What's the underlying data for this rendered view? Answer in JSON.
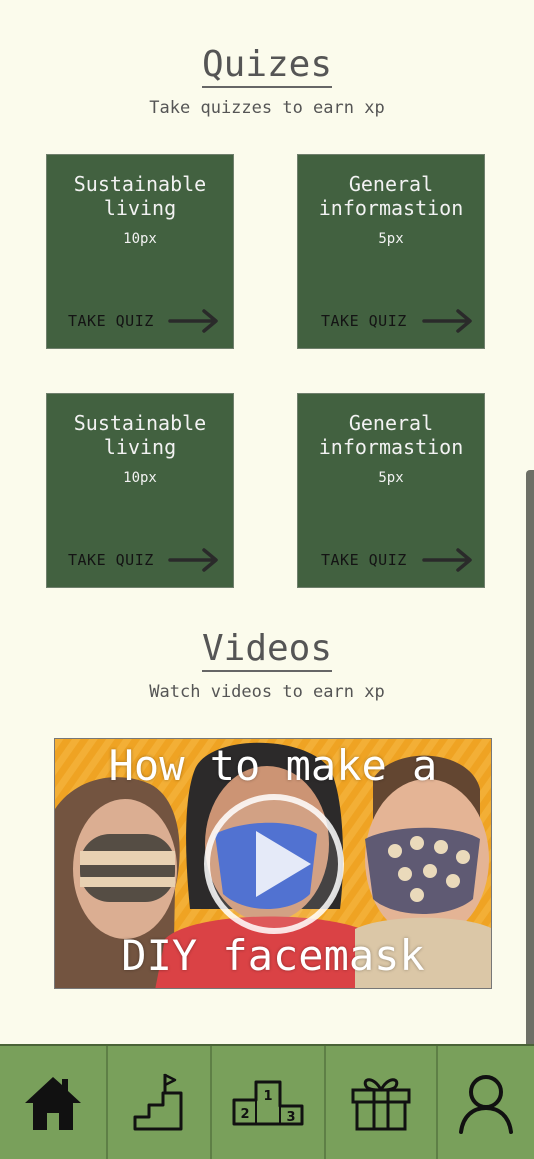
{
  "quizzes": {
    "title": "Quizes",
    "subtitle": "Take quizzes to earn xp",
    "cards": [
      {
        "title_line1": "Sustainable",
        "title_line2": "living",
        "xp": "10px",
        "action": "TAKE QUIZ"
      },
      {
        "title_line1": "General",
        "title_line2": "informastion",
        "xp": "5px",
        "action": "TAKE QUIZ"
      },
      {
        "title_line1": "Sustainable",
        "title_line2": "living",
        "xp": "10px",
        "action": "TAKE QUIZ"
      },
      {
        "title_line1": "General",
        "title_line2": "informastion",
        "xp": "5px",
        "action": "TAKE QUIZ"
      }
    ]
  },
  "videos": {
    "title": "Videos",
    "subtitle": "Watch videos to earn xp",
    "items": [
      {
        "overlay_line1": "How to make a",
        "overlay_line2": "DIY facemask"
      }
    ]
  },
  "bottom_nav": {
    "items": [
      {
        "icon": "home-icon"
      },
      {
        "icon": "stairs-flag-icon"
      },
      {
        "icon": "podium-icon"
      },
      {
        "icon": "gift-icon"
      },
      {
        "icon": "user-icon"
      }
    ]
  },
  "colors": {
    "background": "#fbfbec",
    "card": "#426140",
    "nav": "#79a05b",
    "video_bg": "#ee9e16"
  }
}
